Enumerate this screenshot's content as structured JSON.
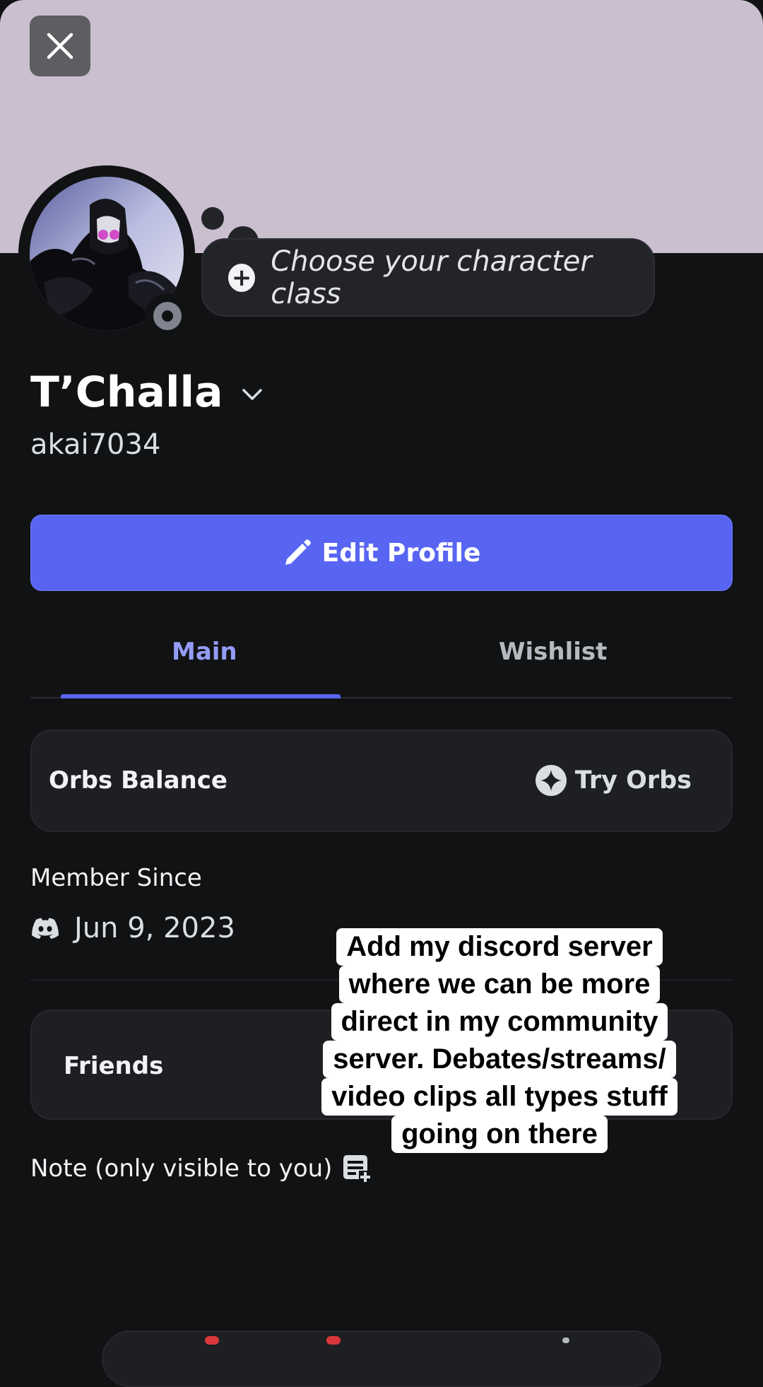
{
  "header": {
    "close_label": "close"
  },
  "profile": {
    "character_class_prompt": "Choose your character class",
    "display_name": "T’Challa",
    "username": "akai7034"
  },
  "actions": {
    "edit_profile_label": "Edit Profile"
  },
  "tabs": [
    {
      "label": "Main",
      "active": true
    },
    {
      "label": "Wishlist",
      "active": false
    }
  ],
  "orbs": {
    "title": "Orbs Balance",
    "try_label": "Try Orbs"
  },
  "member_since": {
    "label": "Member Since",
    "date": "Jun 9, 2023"
  },
  "friends": {
    "title": "Friends"
  },
  "note": {
    "label": "Note (only visible to you)"
  },
  "caption_overlay": {
    "lines": [
      "Add my discord server",
      "where we can be more",
      "direct in my community",
      "server. Debates/streams/",
      "video clips all types stuff",
      "going on there"
    ]
  },
  "colors": {
    "banner": "#c9bfcf",
    "background": "#111214",
    "accent": "#5865f2",
    "active_tab": "#949cf7"
  }
}
